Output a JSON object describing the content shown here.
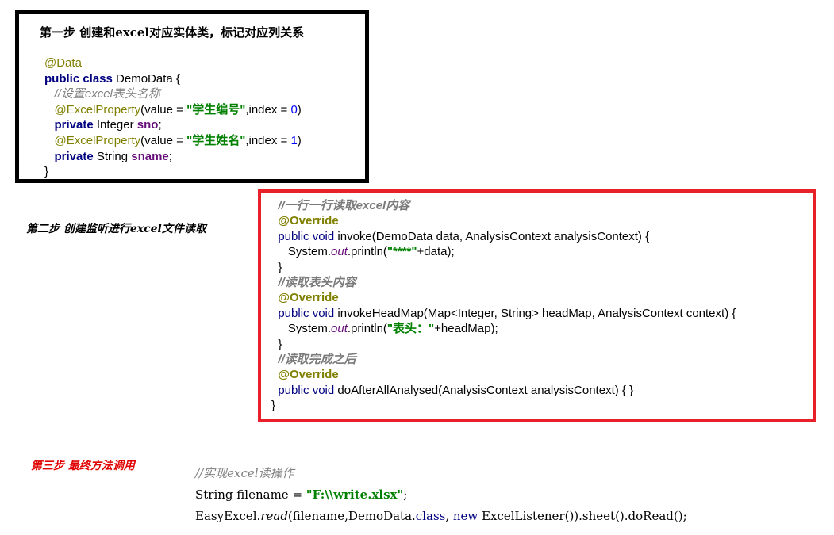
{
  "step1": {
    "title": "第一步 创建和excel对应实体类，标记对应列关系",
    "lines": [
      {
        "ann": "@Data"
      },
      {
        "kw": "public class",
        "rest": " DemoData {"
      },
      {
        "comment": "//设置excel表头名称"
      },
      {
        "ann": "@ExcelProperty",
        "pre": "(value = ",
        "str": "\"学生编号\"",
        "mid": ",index = ",
        "num": "0",
        "post": ")"
      },
      {
        "kw": "private",
        "type": " Integer ",
        "field": "sno",
        "end": ";"
      },
      {
        "ann": "@ExcelProperty",
        "pre": "(value = ",
        "str": "\"学生姓名\"",
        "mid": ",index = ",
        "num": "1",
        "post": ")"
      },
      {
        "kw": "private",
        "type": " String ",
        "field": "sname",
        "end": ";"
      },
      {
        "close": "}"
      }
    ]
  },
  "step2": {
    "label": "第二步 创建监听进行excel文件读取",
    "c1": "//一行一行读取excel内容",
    "override": "@Override",
    "kw_pv": "public void",
    "invoke_sig": " invoke(DemoData data, AnalysisContext analysisContext) {",
    "sys": "System.",
    "out": "out",
    "println1_a": ".println(",
    "println1_str": "\"****\"",
    "println1_b": "+data);",
    "close": "}",
    "c2": "//读取表头内容",
    "head_sig": " invokeHeadMap(Map<Integer, String> headMap, AnalysisContext context) {",
    "println2_str": "\"表头：\"",
    "println2_b": "+headMap);",
    "c3": "//读取完成之后",
    "after_sig": " doAfterAllAnalysed(AnalysisContext analysisContext) { }",
    "final_close": "}"
  },
  "step3": {
    "label": "第三步 最终方法调用",
    "comment": "//实现excel读操作",
    "line2_type": "String filename = ",
    "line2_str": "\"F:\\\\write.xlsx\"",
    "line2_end": ";",
    "line3_a": "EasyExcel.",
    "line3_read": "read",
    "line3_b": "(filename,DemoData.",
    "line3_class": "class",
    "line3_c": ", ",
    "line3_new": "new",
    "line3_d": " ExcelListener()).sheet().doRead();"
  }
}
